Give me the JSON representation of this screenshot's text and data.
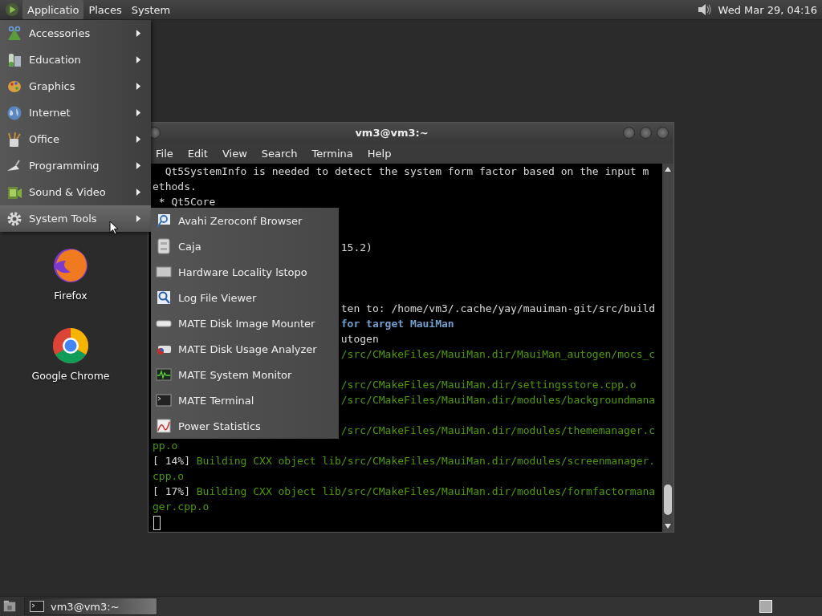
{
  "top_panel": {
    "menus": [
      {
        "label": "Applicatio",
        "selected": true
      },
      {
        "label": "Places",
        "selected": false
      },
      {
        "label": "System",
        "selected": false
      }
    ],
    "clock": "Wed Mar 29, 04:16"
  },
  "desktop_icons": [
    {
      "label": "Firefox"
    },
    {
      "label": "Google Chrome"
    }
  ],
  "terminal": {
    "title": "vm3@vm3:~",
    "menu": [
      "File",
      "Edit",
      "View",
      "Search",
      "Termina",
      "Help"
    ],
    "lines": [
      {
        "kind": "indented",
        "segments": [
          {
            "kind": "plain",
            "text": "Qt5SystemInfo is needed to detect the system form factor based on the input m"
          }
        ]
      },
      {
        "kind": "full",
        "segments": [
          {
            "kind": "plain",
            "text": "ethods."
          }
        ]
      },
      {
        "kind": "bullet",
        "segments": [
          {
            "kind": "plain",
            "text": "* Qt5Core"
          }
        ]
      },
      {
        "kind": "covered"
      },
      {
        "kind": "covered"
      },
      {
        "kind": "tail",
        "segments": [
          {
            "kind": "plain",
            "text": "15.2)"
          }
        ]
      },
      {
        "kind": "covered"
      },
      {
        "kind": "covered"
      },
      {
        "kind": "covered"
      },
      {
        "kind": "tail",
        "segments": [
          {
            "kind": "plain",
            "text": "ten to: /home/vm3/.cache/yay/mauiman-git/src/build"
          }
        ]
      },
      {
        "kind": "tail",
        "segments": [
          {
            "kind": "highlight",
            "text": "for target MauiMan"
          }
        ]
      },
      {
        "kind": "tail",
        "segments": [
          {
            "kind": "plain",
            "text": "utogen"
          }
        ]
      },
      {
        "kind": "tail",
        "segments": [
          {
            "kind": "progress",
            "text": "/src/CMakeFiles/MauiMan.dir/MauiMan_autogen/mocs_c"
          }
        ]
      },
      {
        "kind": "covered"
      },
      {
        "kind": "tail",
        "segments": [
          {
            "kind": "progress",
            "text": "/src/CMakeFiles/MauiMan.dir/settingsstore.cpp.o"
          }
        ]
      },
      {
        "kind": "tail",
        "segments": [
          {
            "kind": "progress",
            "text": "/src/CMakeFiles/MauiMan.dir/modules/backgroundmana"
          }
        ]
      },
      {
        "kind": "covered"
      },
      {
        "kind": "tail",
        "segments": [
          {
            "kind": "progress",
            "text": "/src/CMakeFiles/MauiMan.dir/modules/thememanager.c"
          }
        ]
      },
      {
        "kind": "full",
        "segments": [
          {
            "kind": "progress",
            "text": "pp.o"
          }
        ]
      },
      {
        "kind": "full",
        "segments": [
          {
            "kind": "plain",
            "text": "[ 14%] "
          },
          {
            "kind": "progress",
            "text": "Building CXX object lib/src/CMakeFiles/MauiMan.dir/modules/screenmanager."
          }
        ]
      },
      {
        "kind": "full",
        "segments": [
          {
            "kind": "progress",
            "text": "cpp.o"
          }
        ]
      },
      {
        "kind": "full",
        "segments": [
          {
            "kind": "plain",
            "text": "[ 17%] "
          },
          {
            "kind": "progress",
            "text": "Building CXX object lib/src/CMakeFiles/MauiMan.dir/modules/formfactormana"
          }
        ]
      },
      {
        "kind": "full",
        "segments": [
          {
            "kind": "progress",
            "text": "ger.cpp.o"
          }
        ]
      },
      {
        "kind": "cursor"
      }
    ]
  },
  "applications_menu": {
    "items": [
      {
        "label": "Accessories",
        "selected": false
      },
      {
        "label": "Education",
        "selected": false
      },
      {
        "label": "Graphics",
        "selected": false
      },
      {
        "label": "Internet",
        "selected": false
      },
      {
        "label": "Office",
        "selected": false
      },
      {
        "label": "Programming",
        "selected": false
      },
      {
        "label": "Sound & Video",
        "selected": false
      },
      {
        "label": "System Tools",
        "selected": true
      }
    ]
  },
  "system_tools_menu": {
    "items": [
      "Avahi Zeroconf Browser",
      "Caja",
      "Hardware Locality lstopo",
      "Log File Viewer",
      "MATE Disk Image Mounter",
      "MATE Disk Usage Analyzer",
      "MATE System Monitor",
      "MATE Terminal",
      "Power Statistics"
    ]
  },
  "taskbar": {
    "windows": [
      {
        "label": "vm3@vm3:~"
      }
    ]
  }
}
